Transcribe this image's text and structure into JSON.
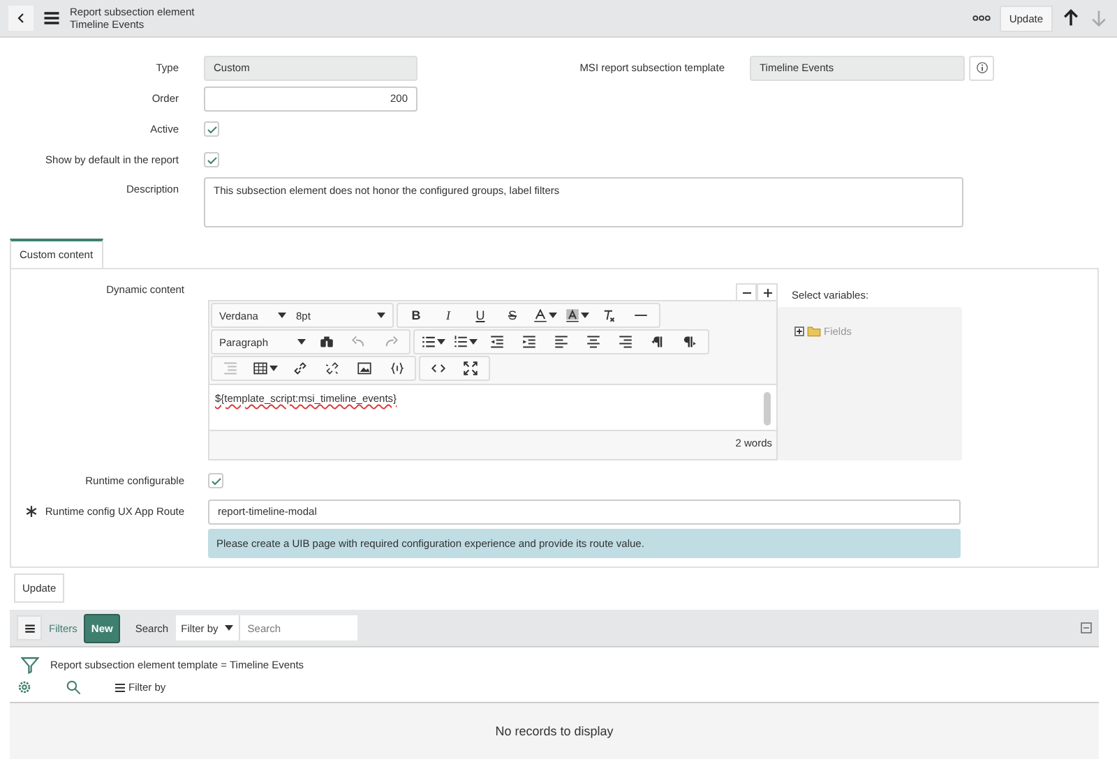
{
  "header": {
    "title": "Report subsection element",
    "subtitle": "Timeline Events",
    "update_button": "Update"
  },
  "form": {
    "type": {
      "label": "Type",
      "value": "Custom"
    },
    "template": {
      "label": "MSI report subsection template",
      "value": "Timeline Events"
    },
    "order": {
      "label": "Order",
      "value": "200"
    },
    "active": {
      "label": "Active",
      "checked": true
    },
    "show_default": {
      "label": "Show by default in the report",
      "checked": true
    },
    "description": {
      "label": "Description",
      "value": "This subsection element does not honor the configured groups, label filters"
    }
  },
  "tabs": [
    {
      "label": "Custom content",
      "selected": true
    }
  ],
  "custom": {
    "dynamic_label": "Dynamic content",
    "editor": {
      "font": "Verdana",
      "size": "8pt",
      "block": "Paragraph",
      "format_buttons": [
        "B",
        "I",
        "U",
        "S"
      ],
      "content": "${template_script:msi_timeline_events}",
      "word_count": "2 words"
    },
    "variables": {
      "label": "Select variables:",
      "tree": [
        {
          "label": "Fields",
          "expanded": false
        }
      ]
    },
    "runtime": {
      "label": "Runtime configurable",
      "checked": true
    },
    "route": {
      "label": "Runtime config UX App Route",
      "required": true,
      "value": "report-timeline-modal"
    },
    "info": "Please create a UIB page with required configuration experience and provide its route value."
  },
  "update_button": "Update",
  "related_list": {
    "filters": "Filters",
    "new_button": "New",
    "search_label": "Search",
    "filter_select": "Filter by",
    "search_placeholder": "Search",
    "breadcrumb": "Report subsection element template = Timeline Events",
    "filter_by": "Filter by",
    "empty": "No records to display"
  }
}
